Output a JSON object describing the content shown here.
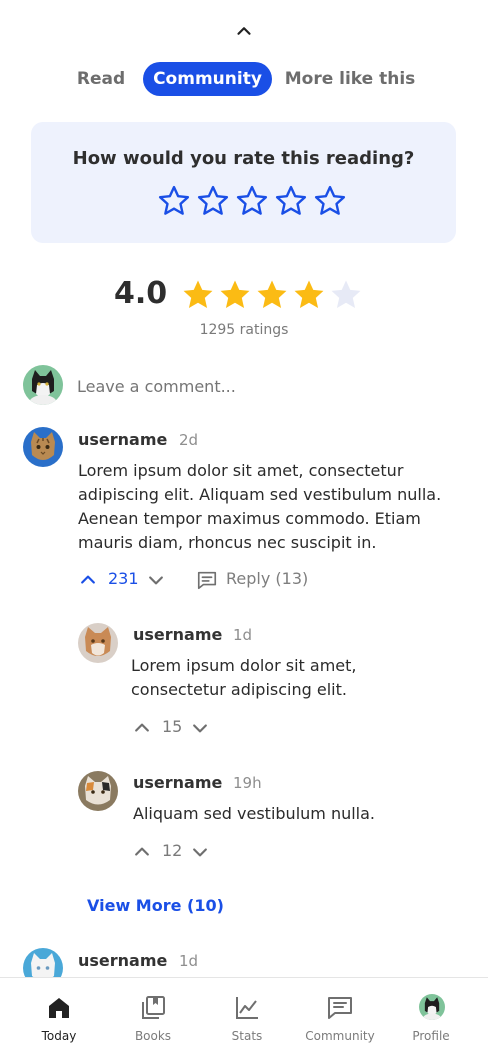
{
  "tabs": [
    {
      "label": "Read",
      "active": false
    },
    {
      "label": "Community",
      "active": true
    },
    {
      "label": "More like this",
      "active": false
    }
  ],
  "rate_prompt": {
    "question": "How would you rate this reading?",
    "stars": 5,
    "selected": 0
  },
  "rating_summary": {
    "value": "4.0",
    "stars_filled": 4,
    "stars_total": 5,
    "count_label": "1295 ratings"
  },
  "comment_input": {
    "placeholder": "Leave a comment..."
  },
  "comments": [
    {
      "username": "username",
      "time": "2d",
      "text": "Lorem ipsum dolor sit amet, consectetur adipiscing elit. Aliquam sed vestibulum nulla. Aenean tempor maximus commodo. Etiam mauris diam, rhoncus nec suscipit in.",
      "votes": "231",
      "upvoted": true,
      "reply_label": "Reply (13)",
      "replies": [
        {
          "username": "username",
          "time": "1d",
          "text": "Lorem ipsum dolor sit amet, consectetur adipiscing elit.",
          "votes": "15"
        },
        {
          "username": "username",
          "time": "19h",
          "text": "Aliquam sed vestibulum nulla.",
          "votes": "12"
        }
      ],
      "view_more_label": "View More (10)"
    },
    {
      "username": "username",
      "time": "1d"
    }
  ],
  "bottom_nav": [
    {
      "label": "Today",
      "icon": "home-icon",
      "active": true
    },
    {
      "label": "Books",
      "icon": "books-icon",
      "active": false
    },
    {
      "label": "Stats",
      "icon": "stats-icon",
      "active": false
    },
    {
      "label": "Community",
      "icon": "community-icon",
      "active": false
    },
    {
      "label": "Profile",
      "icon": "profile-avatar",
      "active": false
    }
  ],
  "colors": {
    "accent": "#1a4fe6",
    "star_gold": "#fbbb14",
    "star_empty": "#e7eaf6",
    "card_bg": "#eef2fd"
  }
}
